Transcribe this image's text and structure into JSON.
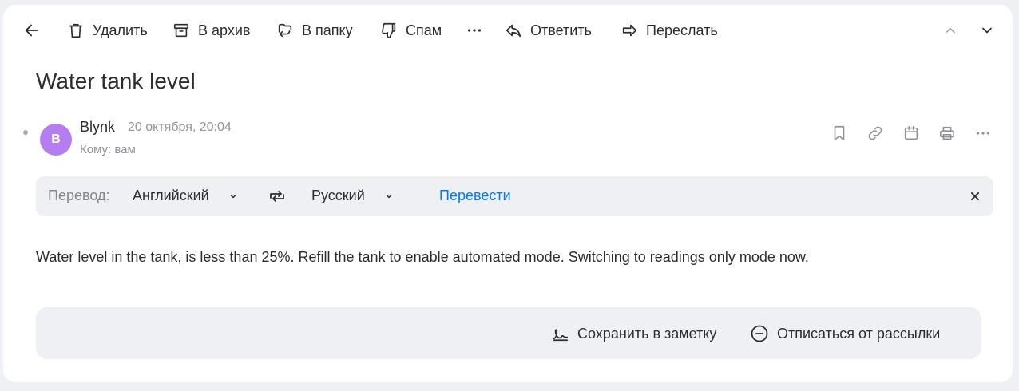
{
  "toolbar": {
    "delete_label": "Удалить",
    "archive_label": "В архив",
    "move_label": "В папку",
    "spam_label": "Спам",
    "more_label": "⋯",
    "reply_label": "Ответить",
    "forward_label": "Переслать"
  },
  "message": {
    "subject": "Water tank level",
    "avatar_letter": "B",
    "sender": "Blynk",
    "date": "20 октября, 20:04",
    "recipient": "Кому: вам",
    "body": "Water level in the tank, is less than 25%. Refill the tank to enable automated mode. Switching to readings only mode now."
  },
  "translation": {
    "label": "Перевод:",
    "from_lang": "Английский",
    "to_lang": "Русский",
    "action": "Перевести"
  },
  "footer": {
    "save_note_label": "Сохранить в заметку",
    "unsubscribe_label": "Отписаться от рассылки"
  },
  "colors": {
    "accent": "#0077ff",
    "avatar": "#b67df0",
    "panel": "#eef0f3"
  }
}
